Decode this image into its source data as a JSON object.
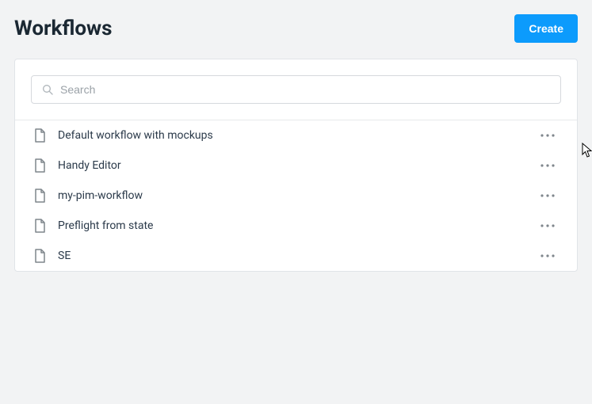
{
  "header": {
    "title": "Workflows",
    "create_label": "Create"
  },
  "search": {
    "placeholder": "Search",
    "value": ""
  },
  "workflows": [
    {
      "name": "Default workflow with mockups"
    },
    {
      "name": "Handy Editor"
    },
    {
      "name": "my-pim-workflow"
    },
    {
      "name": "Preflight from state"
    },
    {
      "name": "SE"
    }
  ]
}
